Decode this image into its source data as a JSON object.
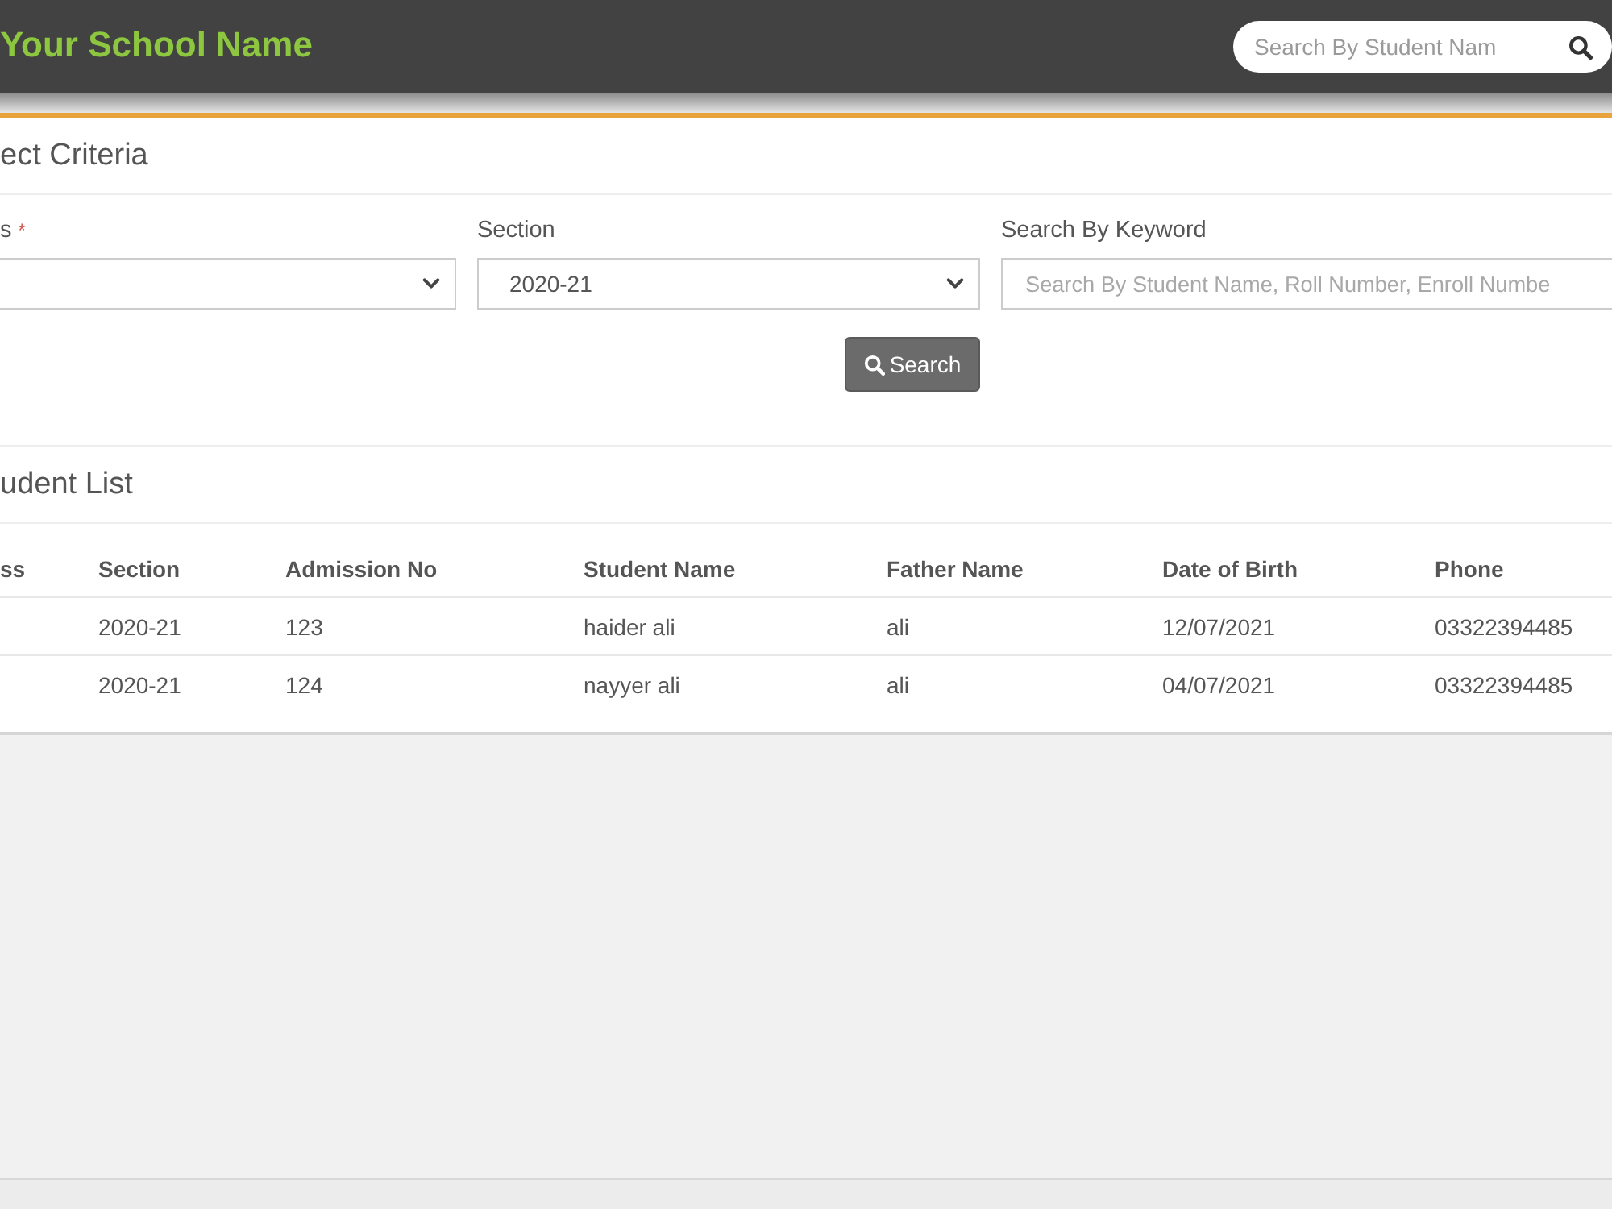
{
  "header": {
    "title": "Your School Name",
    "search": {
      "placeholder": "Search By Student Nam"
    }
  },
  "criteria": {
    "title": "ect Criteria",
    "fields": [
      {
        "kind": "select",
        "label": "s",
        "required_mark": "*"
      },
      {
        "kind": "select",
        "label": "Section",
        "value": "2020-21"
      },
      {
        "kind": "text",
        "label": "Search By Keyword",
        "placeholder": "Search By Student Name, Roll Number, Enroll Numbe"
      }
    ],
    "button": "Search"
  },
  "student_list": {
    "title": "udent List",
    "columns": [
      "ss",
      "Section",
      "Admission No",
      "Student Name",
      "Father Name",
      "Date of Birth",
      "Phone"
    ],
    "rows": [
      {
        "cells": [
          "",
          "2020-21",
          "123",
          "haider ali",
          "ali",
          "12/07/2021",
          "03322394485"
        ]
      },
      {
        "cells": [
          "",
          "2020-21",
          "124",
          "nayyer ali",
          "ali",
          "04/07/2021",
          "03322394485"
        ]
      }
    ]
  }
}
